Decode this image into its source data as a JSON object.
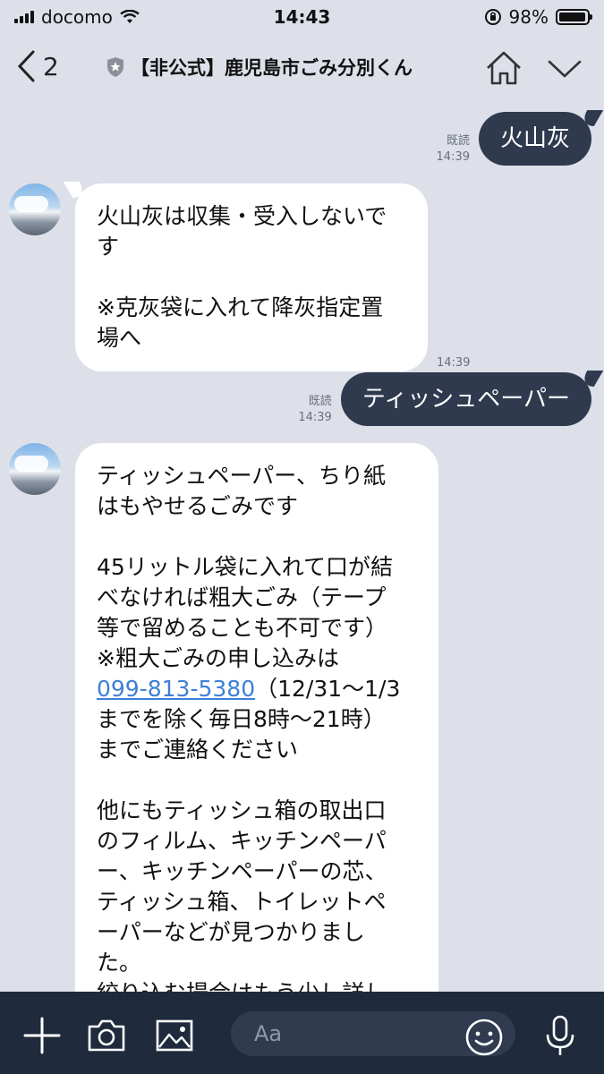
{
  "status_bar": {
    "carrier": "docomo",
    "time": "14:43",
    "battery_percent": "98%",
    "battery_level": 0.98
  },
  "header": {
    "back_count": "2",
    "title": "【非公式】鹿児島市ごみ分別くん"
  },
  "messages": [
    {
      "direction": "out",
      "read_label": "既読",
      "time": "14:39",
      "text": "火山灰"
    },
    {
      "direction": "in",
      "time": "14:39",
      "text": "火山灰は収集・受入しないで\nす\n\n※克灰袋に入れて降灰指定置\n場へ"
    },
    {
      "direction": "out",
      "read_label": "既読",
      "time": "14:39",
      "text": "ティッシュペーパー"
    },
    {
      "direction": "in",
      "text_before_link": "ティッシュペーパー、ちり紙\nはもやせるごみです\n\n45リットル袋に入れて口が結\nべなければ粗大ごみ（テープ\n等で留めることも不可です）\n※粗大ごみの申し込みは\n",
      "link": "099-813-5380",
      "text_after_link": "（12/31〜1/3\nまでを除く毎日8時〜21時）\nまでご連絡ください\n\n他にもティッシュ箱の取出口\nのフィルム、キッチンペーパ\nー、キッチンペーパーの芯、\nティッシュ箱、トイレットペ\nーパーなどが見つかりまし\nた。\n絞り込む場合はもう少し詳し"
    }
  ],
  "input_bar": {
    "placeholder": "Aa",
    "icons": [
      "plus-icon",
      "camera-icon",
      "image-icon",
      "smiley-icon",
      "mic-icon"
    ]
  },
  "colors": {
    "background": "#dde0e9",
    "outgoing_bubble": "#2f3a4f",
    "incoming_bubble": "#ffffff",
    "input_bar": "#1f2a3d",
    "link": "#3d7fd6"
  }
}
